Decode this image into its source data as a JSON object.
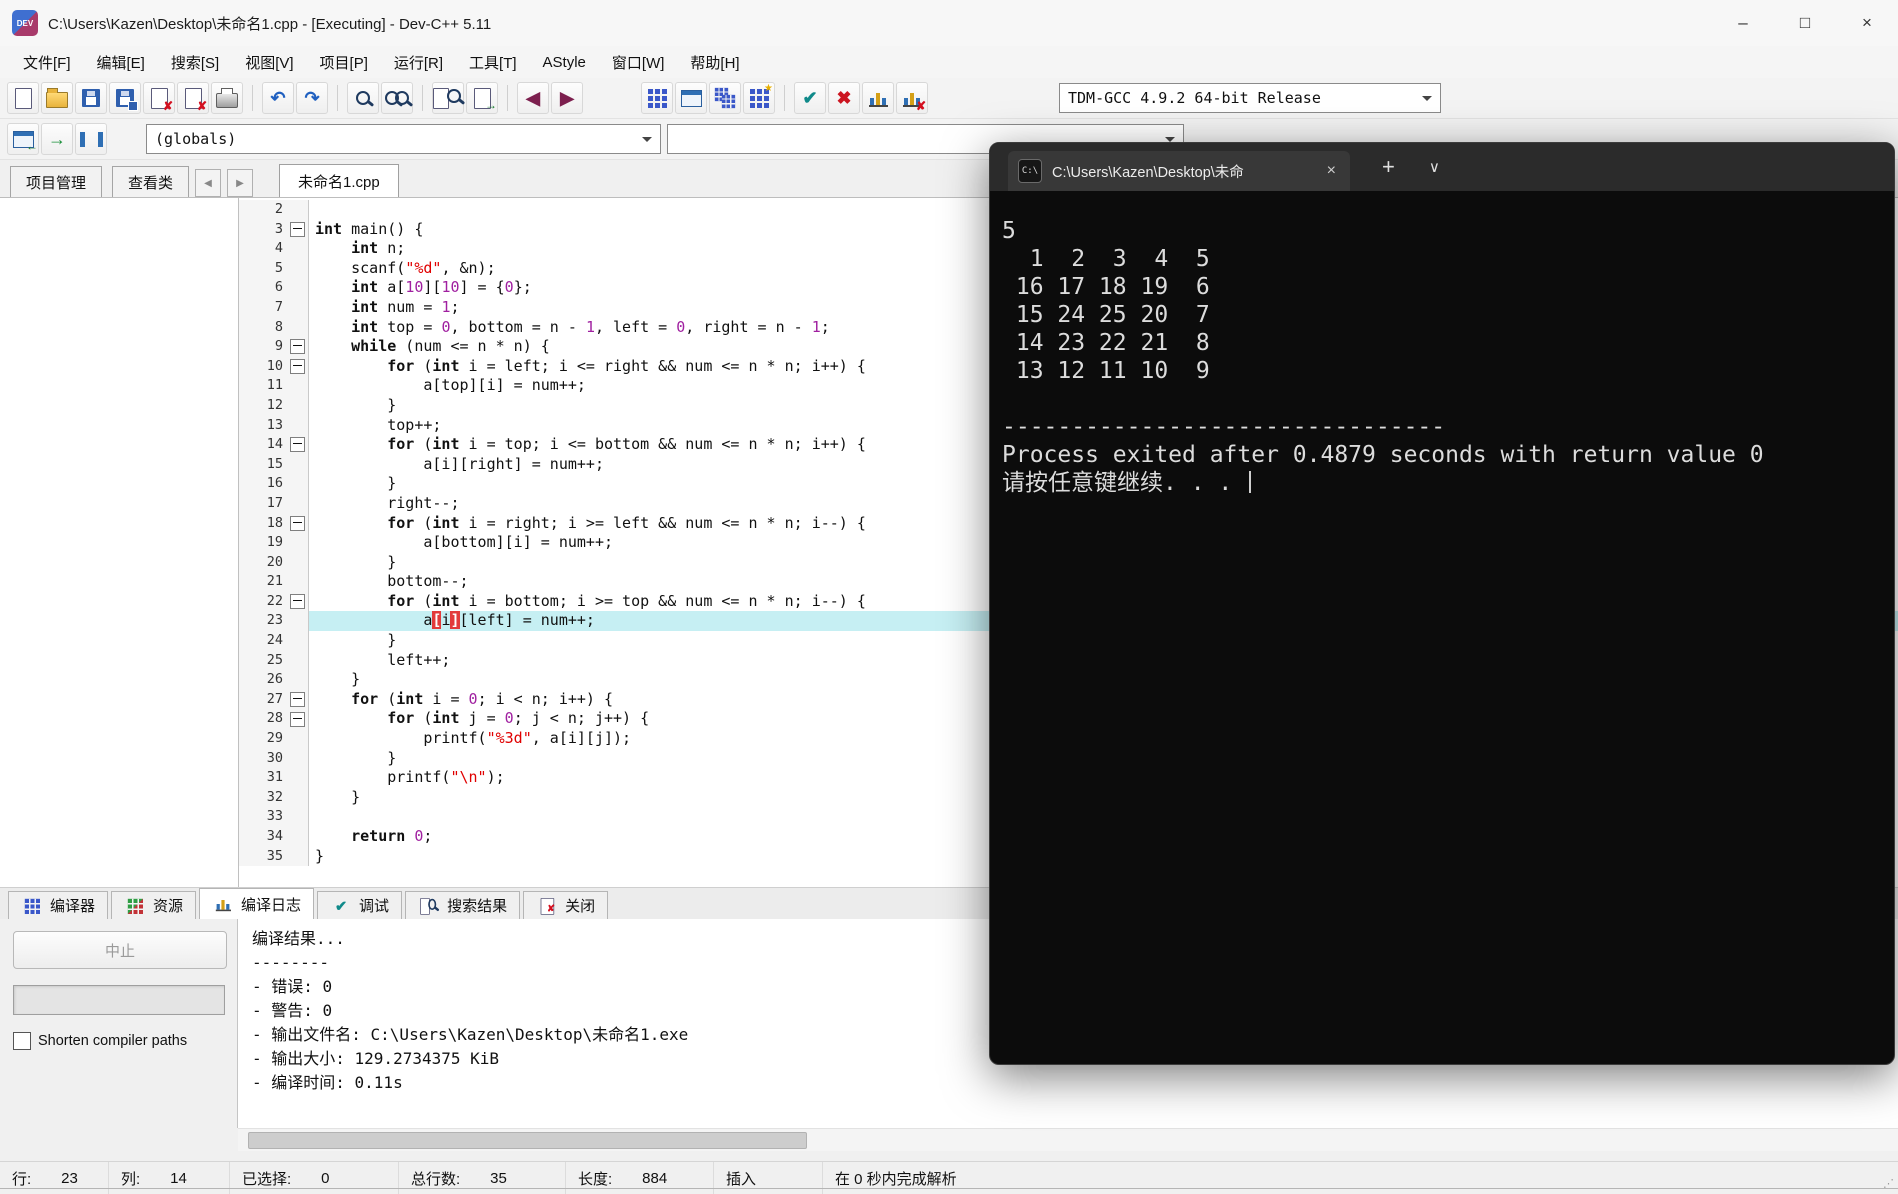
{
  "window": {
    "title": "C:\\Users\\Kazen\\Desktop\\未命名1.cpp - [Executing] - Dev-C++ 5.11",
    "app_icon_label": "DEV",
    "controls": {
      "minimize": "–",
      "maximize": "□",
      "close": "×"
    }
  },
  "menu": {
    "items": [
      "文件[F]",
      "编辑[E]",
      "搜索[S]",
      "视图[V]",
      "项目[P]",
      "运行[R]",
      "工具[T]",
      "AStyle",
      "窗口[W]",
      "帮助[H]"
    ]
  },
  "toolbar": {
    "compiler_combo": "TDM-GCC 4.9.2 64-bit Release",
    "globals_combo": "(globals)",
    "members_combo": "",
    "row1": [
      {
        "name": "new-file",
        "type": "page"
      },
      {
        "name": "open-file",
        "type": "folder"
      },
      {
        "name": "save",
        "type": "floppy"
      },
      {
        "name": "save-all",
        "type": "floppy2"
      },
      {
        "name": "close-file",
        "type": "page-x"
      },
      {
        "name": "close-all",
        "type": "page-x2"
      },
      {
        "name": "print",
        "type": "printer"
      },
      {
        "type": "sep"
      },
      {
        "name": "undo",
        "type": "glyph",
        "glyph": "↶",
        "color": "#2060c0"
      },
      {
        "name": "redo",
        "type": "glyph",
        "glyph": "↷",
        "color": "#2060c0"
      },
      {
        "type": "sep"
      },
      {
        "name": "find",
        "type": "mag"
      },
      {
        "name": "replace",
        "type": "mag2"
      },
      {
        "type": "sep"
      },
      {
        "name": "find-in-files",
        "type": "mag-page"
      },
      {
        "name": "goto-line",
        "type": "page-arrow"
      },
      {
        "type": "sep"
      },
      {
        "name": "back",
        "type": "glyph",
        "glyph": "◀",
        "color": "#7c1f4e"
      },
      {
        "name": "forward",
        "type": "glyph",
        "glyph": "▶",
        "color": "#7c1f4e"
      },
      {
        "type": "gap"
      },
      {
        "name": "compile",
        "type": "grid"
      },
      {
        "name": "run",
        "type": "window"
      },
      {
        "name": "compile-run",
        "type": "grid2"
      },
      {
        "name": "rebuild-all",
        "type": "grid-star"
      },
      {
        "type": "sep"
      },
      {
        "name": "syntax-check",
        "type": "glyph",
        "glyph": "✔",
        "color": "#108a8a"
      },
      {
        "name": "abort-compile",
        "type": "glyph",
        "glyph": "✖",
        "color": "#cc1520"
      },
      {
        "name": "profile",
        "type": "chart"
      },
      {
        "name": "profile-delete",
        "type": "chart-x"
      }
    ],
    "row2": [
      {
        "name": "insert",
        "type": "win-arrow"
      },
      {
        "name": "toggle-bookmark",
        "type": "glyph",
        "glyph": "→",
        "color": "#1a8f3a"
      },
      {
        "name": "goto-bookmark",
        "type": "pause"
      }
    ]
  },
  "explorer": {
    "project_tab": "项目管理",
    "class_tab": "查看类",
    "scroll_left": "◀",
    "scroll_right": "▶"
  },
  "editor": {
    "tab": "未命名1.cpp",
    "lines": [
      {
        "n": 2,
        "s": []
      },
      {
        "n": 3,
        "f": 1,
        "s": [
          [
            "k",
            "int"
          ],
          [
            "p",
            " main() {"
          ]
        ]
      },
      {
        "n": 4,
        "s": [
          [
            "p",
            "    "
          ],
          [
            "k",
            "int"
          ],
          [
            "p",
            " n;"
          ]
        ]
      },
      {
        "n": 5,
        "s": [
          [
            "p",
            "    scanf("
          ],
          [
            "s",
            "\"%d\""
          ],
          [
            "p",
            ", &n);"
          ]
        ]
      },
      {
        "n": 6,
        "s": [
          [
            "p",
            "    "
          ],
          [
            "k",
            "int"
          ],
          [
            "p",
            " a["
          ],
          [
            "n",
            "10"
          ],
          [
            "p",
            "]["
          ],
          [
            "n",
            "10"
          ],
          [
            "p",
            "] = {"
          ],
          [
            "n",
            "0"
          ],
          [
            "p",
            "};"
          ]
        ]
      },
      {
        "n": 7,
        "s": [
          [
            "p",
            "    "
          ],
          [
            "k",
            "int"
          ],
          [
            "p",
            " num = "
          ],
          [
            "n",
            "1"
          ],
          [
            "p",
            ";"
          ]
        ]
      },
      {
        "n": 8,
        "s": [
          [
            "p",
            "    "
          ],
          [
            "k",
            "int"
          ],
          [
            "p",
            " top = "
          ],
          [
            "n",
            "0"
          ],
          [
            "p",
            ", bottom = n - "
          ],
          [
            "n",
            "1"
          ],
          [
            "p",
            ", left = "
          ],
          [
            "n",
            "0"
          ],
          [
            "p",
            ", right = n - "
          ],
          [
            "n",
            "1"
          ],
          [
            "p",
            ";"
          ]
        ]
      },
      {
        "n": 9,
        "f": 1,
        "s": [
          [
            "p",
            "    "
          ],
          [
            "k",
            "while"
          ],
          [
            "p",
            " (num <= n * n) {"
          ]
        ]
      },
      {
        "n": 10,
        "f": 1,
        "s": [
          [
            "p",
            "        "
          ],
          [
            "k",
            "for"
          ],
          [
            "p",
            " ("
          ],
          [
            "k",
            "int"
          ],
          [
            "p",
            " i = left; i <= right && num <= n * n; i++) {"
          ]
        ]
      },
      {
        "n": 11,
        "s": [
          [
            "p",
            "            a[top][i] = num++;"
          ]
        ]
      },
      {
        "n": 12,
        "s": [
          [
            "p",
            "        }"
          ]
        ]
      },
      {
        "n": 13,
        "s": [
          [
            "p",
            "        top++;"
          ]
        ]
      },
      {
        "n": 14,
        "f": 1,
        "s": [
          [
            "p",
            "        "
          ],
          [
            "k",
            "for"
          ],
          [
            "p",
            " ("
          ],
          [
            "k",
            "int"
          ],
          [
            "p",
            " i = top; i <= bottom && num <= n * n; i++) {"
          ]
        ]
      },
      {
        "n": 15,
        "s": [
          [
            "p",
            "            a[i][right] = num++;"
          ]
        ]
      },
      {
        "n": 16,
        "s": [
          [
            "p",
            "        }"
          ]
        ]
      },
      {
        "n": 17,
        "s": [
          [
            "p",
            "        right--;"
          ]
        ]
      },
      {
        "n": 18,
        "f": 1,
        "s": [
          [
            "p",
            "        "
          ],
          [
            "k",
            "for"
          ],
          [
            "p",
            " ("
          ],
          [
            "k",
            "int"
          ],
          [
            "p",
            " i = right; i >= left && num <= n * n; i--) {"
          ]
        ]
      },
      {
        "n": 19,
        "s": [
          [
            "p",
            "            a[bottom][i] = num++;"
          ]
        ]
      },
      {
        "n": 20,
        "s": [
          [
            "p",
            "        }"
          ]
        ]
      },
      {
        "n": 21,
        "s": [
          [
            "p",
            "        bottom--;"
          ]
        ]
      },
      {
        "n": 22,
        "f": 1,
        "s": [
          [
            "p",
            "        "
          ],
          [
            "k",
            "for"
          ],
          [
            "p",
            " ("
          ],
          [
            "k",
            "int"
          ],
          [
            "p",
            " i = bottom; i >= top && num <= n * n; i--) {"
          ]
        ]
      },
      {
        "n": 23,
        "hl": 1,
        "s": [
          [
            "p",
            "            a"
          ],
          [
            "r",
            "["
          ],
          [
            "p",
            "i"
          ],
          [
            "r",
            "]"
          ],
          [
            "p",
            "[left] = num++;"
          ]
        ]
      },
      {
        "n": 24,
        "s": [
          [
            "p",
            "        }"
          ]
        ]
      },
      {
        "n": 25,
        "s": [
          [
            "p",
            "        left++;"
          ]
        ]
      },
      {
        "n": 26,
        "s": [
          [
            "p",
            "    }"
          ]
        ]
      },
      {
        "n": 27,
        "f": 1,
        "s": [
          [
            "p",
            "    "
          ],
          [
            "k",
            "for"
          ],
          [
            "p",
            " ("
          ],
          [
            "k",
            "int"
          ],
          [
            "p",
            " i = "
          ],
          [
            "n",
            "0"
          ],
          [
            "p",
            "; i < n; i++) {"
          ]
        ]
      },
      {
        "n": 28,
        "f": 1,
        "s": [
          [
            "p",
            "        "
          ],
          [
            "k",
            "for"
          ],
          [
            "p",
            " ("
          ],
          [
            "k",
            "int"
          ],
          [
            "p",
            " j = "
          ],
          [
            "n",
            "0"
          ],
          [
            "p",
            "; j < n; j++) {"
          ]
        ]
      },
      {
        "n": 29,
        "s": [
          [
            "p",
            "            printf("
          ],
          [
            "s",
            "\"%3d\""
          ],
          [
            "p",
            ", a[i][j]);"
          ]
        ]
      },
      {
        "n": 30,
        "s": [
          [
            "p",
            "        }"
          ]
        ]
      },
      {
        "n": 31,
        "s": [
          [
            "p",
            "        printf("
          ],
          [
            "s",
            "\"\\n\""
          ],
          [
            "p",
            ");"
          ]
        ]
      },
      {
        "n": 32,
        "s": [
          [
            "p",
            "    }"
          ]
        ]
      },
      {
        "n": 33,
        "s": []
      },
      {
        "n": 34,
        "s": [
          [
            "p",
            "    "
          ],
          [
            "k",
            "return"
          ],
          [
            "p",
            " "
          ],
          [
            "n",
            "0"
          ],
          [
            "p",
            ";"
          ]
        ]
      },
      {
        "n": 35,
        "s": [
          [
            "p",
            "}"
          ]
        ]
      }
    ]
  },
  "terminal": {
    "tab_title": "C:\\Users\\Kazen\\Desktop\\未命",
    "icon_label": "C:\\",
    "close_tab": "×",
    "new_tab": "+",
    "menu": "∨",
    "lines": [
      "5",
      "  1  2  3  4  5",
      " 16 17 18 19  6",
      " 15 24 25 20  7",
      " 14 23 22 21  8",
      " 13 12 11 10  9",
      "",
      "--------------------------------",
      "Process exited after 0.4879 seconds with return value 0",
      "请按任意键继续. . . "
    ]
  },
  "bottom_tabs": [
    {
      "label": "编译器",
      "icon": "grid"
    },
    {
      "label": "资源",
      "icon": "grid-rg"
    },
    {
      "label": "编译日志",
      "icon": "chart",
      "active": true
    },
    {
      "label": "调试",
      "icon": "check"
    },
    {
      "label": "搜索结果",
      "icon": "mag-page"
    },
    {
      "label": "关闭",
      "icon": "page-x"
    }
  ],
  "compile_panel": {
    "abort_label": "中止",
    "shorten_label": "Shorten compiler paths",
    "log": [
      "编译结果...",
      "--------",
      "- 错误: 0",
      "- 警告: 0",
      "- 输出文件名: C:\\Users\\Kazen\\Desktop\\未命名1.exe",
      "- 输出大小: 129.2734375 KiB",
      "- 编译时间: 0.11s"
    ]
  },
  "status": {
    "segments": [
      {
        "label": "行:",
        "value": "23"
      },
      {
        "label": "列:",
        "value": "14"
      },
      {
        "label": "已选择:",
        "value": "0"
      },
      {
        "label": "总行数:",
        "value": "35"
      },
      {
        "label": "长度:",
        "value": "884"
      },
      {
        "label": "插入",
        "value": ""
      },
      {
        "label": "在 0 秒内完成解析",
        "value": ""
      }
    ]
  }
}
